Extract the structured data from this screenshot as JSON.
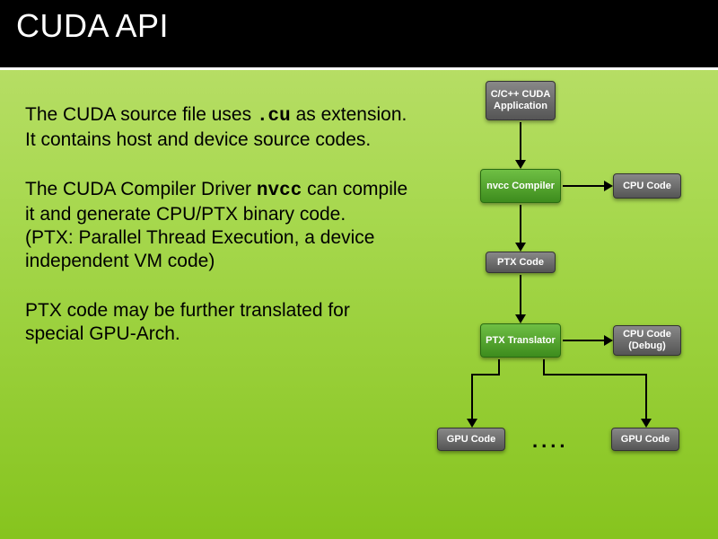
{
  "title": "CUDA API",
  "para1_a": "The CUDA source file uses ",
  "para1_code": ".cu",
  "para1_b": " as extension. It contains host and device source codes.",
  "para2_a": "The CUDA Compiler Driver ",
  "para2_code": "nvcc",
  "para2_b": " can compile it and generate CPU/PTX binary code.\n(PTX: Parallel Thread Execution, a device independent VM code)",
  "para3": "PTX code may be further translated for special GPU-Arch.",
  "diagram": {
    "app": "C/C++\nCUDA\nApplication",
    "nvcc": "nvcc\nCompiler",
    "cpu_code": "CPU Code",
    "ptx_code": "PTX Code",
    "ptx_trans": "PTX\nTranslator",
    "cpu_debug": "CPU Code\n(Debug)",
    "gpu_code1": "GPU Code",
    "gpu_code2": "GPU Code",
    "dots": "...."
  }
}
